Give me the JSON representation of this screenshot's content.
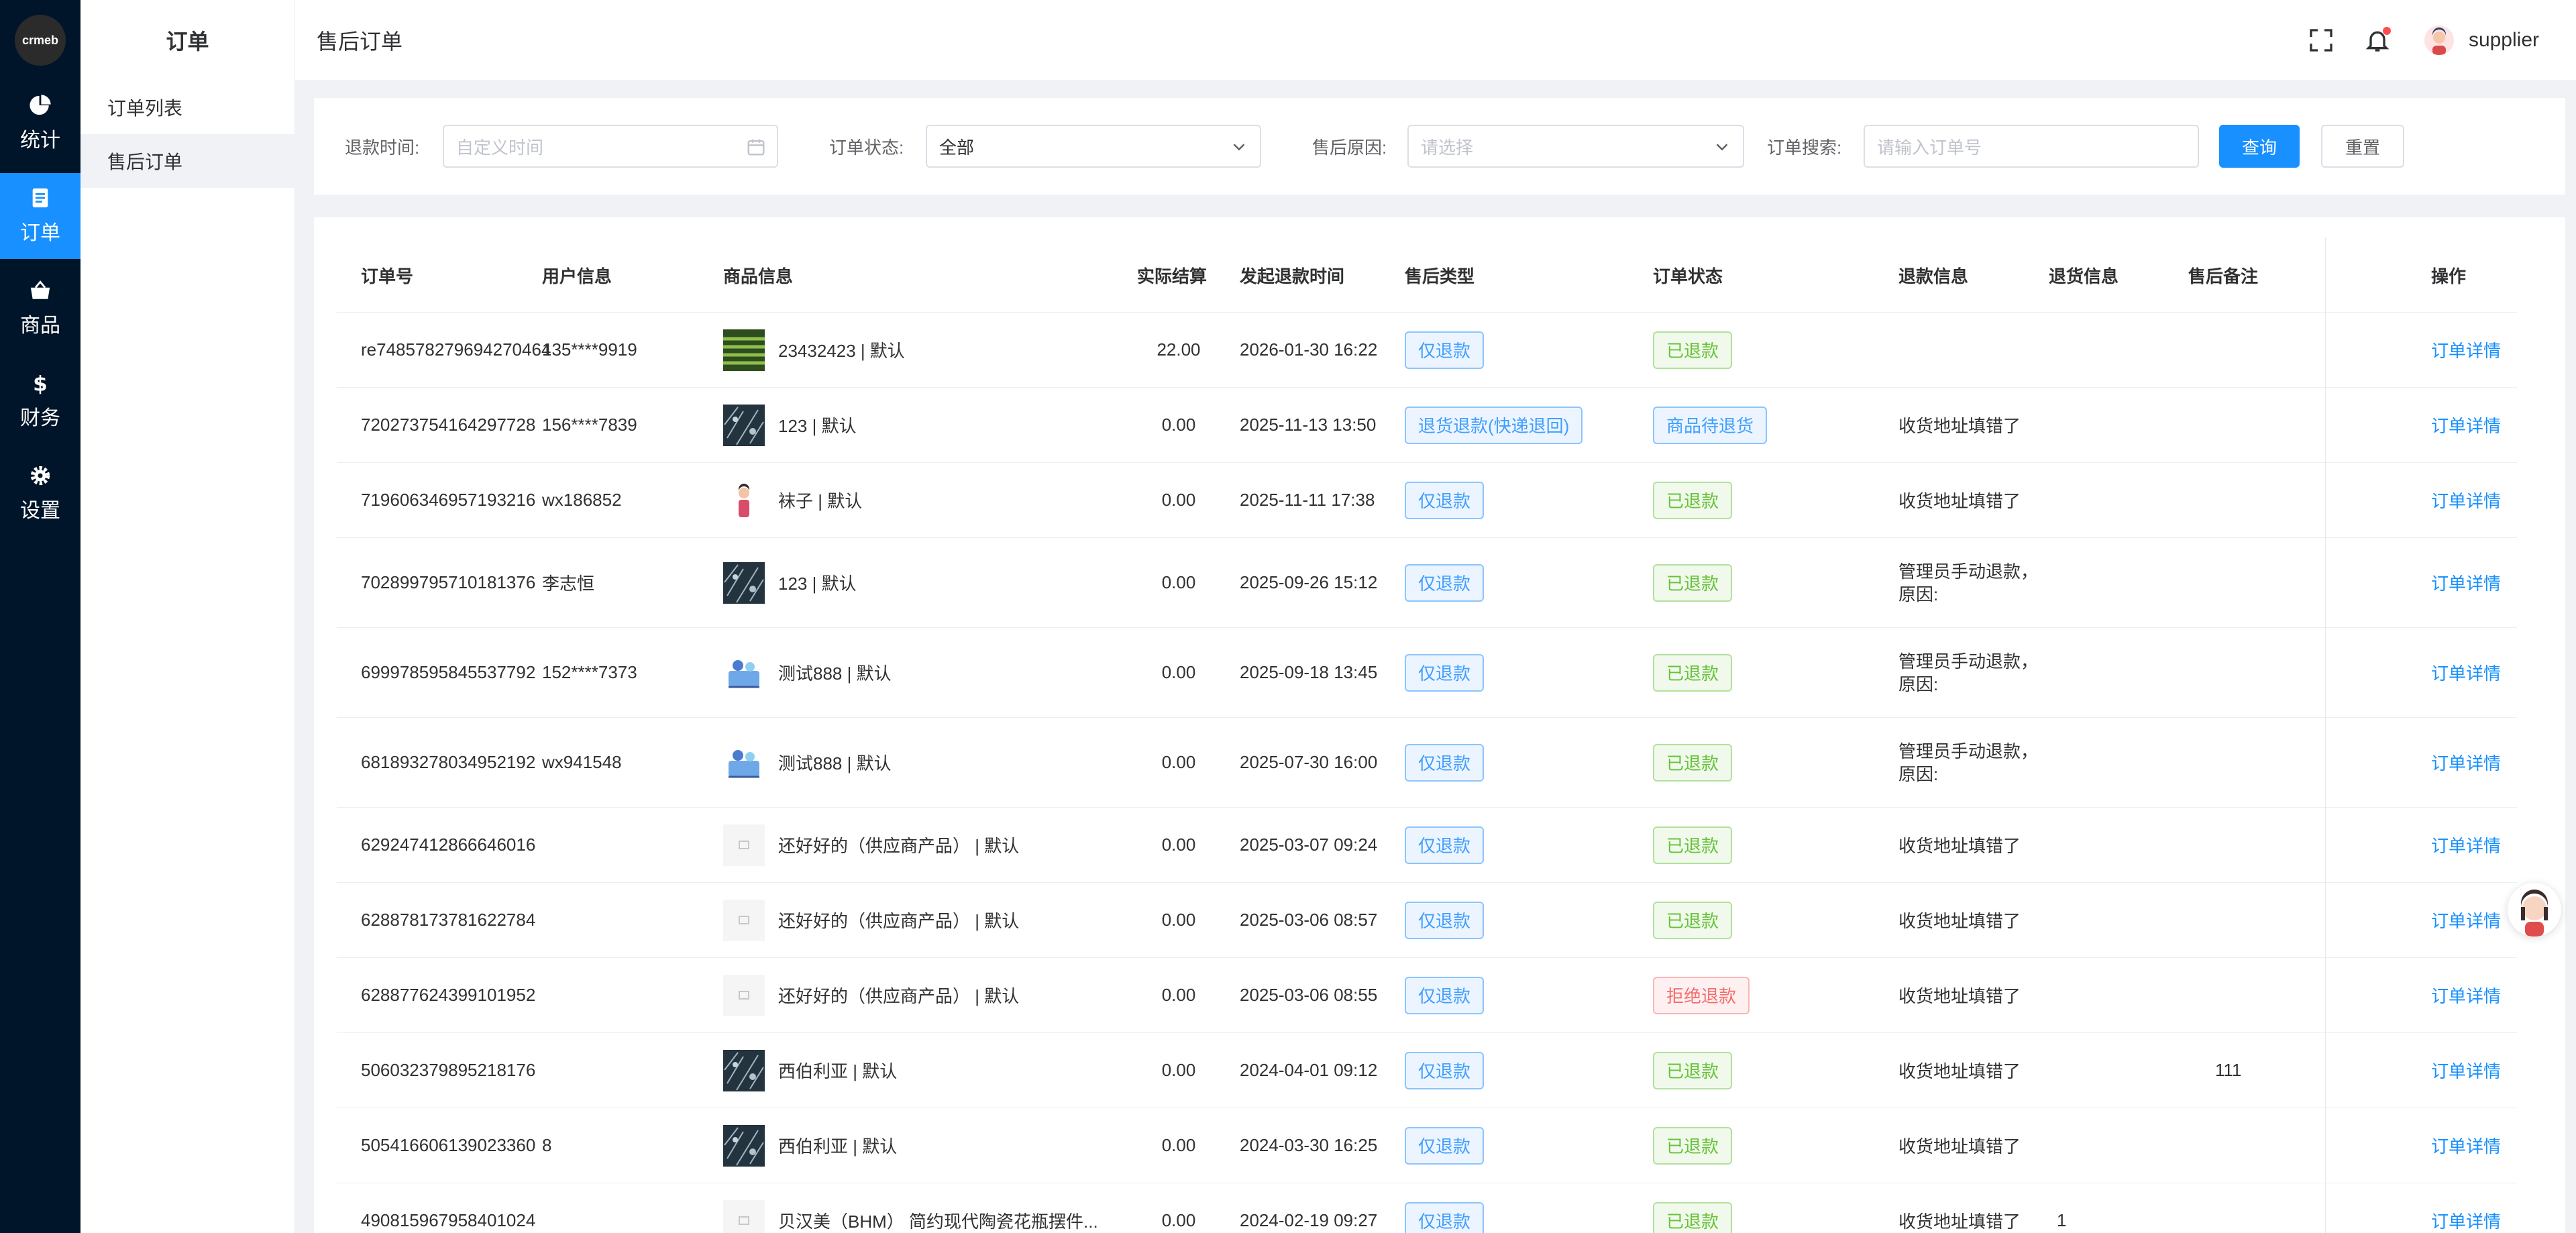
{
  "app": {
    "logo_text": "crmeb"
  },
  "rail": {
    "items": [
      {
        "label": "统计",
        "icon": "pie-chart-icon",
        "active": false
      },
      {
        "label": "订单",
        "icon": "order-document-icon",
        "active": true
      },
      {
        "label": "商品",
        "icon": "shopping-basket-icon",
        "active": false
      },
      {
        "label": "财务",
        "icon": "dollar-icon",
        "active": false
      },
      {
        "label": "设置",
        "icon": "gear-icon",
        "active": false
      }
    ]
  },
  "subnav": {
    "title": "订单",
    "items": [
      {
        "label": "订单列表",
        "active": false
      },
      {
        "label": "售后订单",
        "active": true
      }
    ]
  },
  "header": {
    "title": "售后订单",
    "username": "supplier",
    "icons": [
      "fullscreen-icon",
      "bell-icon"
    ]
  },
  "filters": {
    "refund_time": {
      "label": "退款时间:",
      "placeholder": "自定义时间"
    },
    "order_status": {
      "label": "订单状态:",
      "value": "全部"
    },
    "reason": {
      "label": "售后原因:",
      "placeholder": "请选择"
    },
    "search": {
      "label": "订单搜索:",
      "placeholder": "请输入订单号"
    },
    "query_label": "查询",
    "reset_label": "重置"
  },
  "table": {
    "columns": [
      "订单号",
      "用户信息",
      "商品信息",
      "实际结算",
      "发起退款时间",
      "售后类型",
      "订单状态",
      "退款信息",
      "退货信息",
      "售后备注",
      "操作"
    ],
    "rows": [
      {
        "order_no": "re748578279694270464",
        "user": "135****9919",
        "product": "23432423 | 默认",
        "thumb": "green",
        "amount": "22.00",
        "time": "2026-01-30 16:22",
        "type": "仅退款",
        "status": "已退款",
        "status_color": "green",
        "refund_info": "",
        "return_info": "",
        "remark": "",
        "action": "订单详情"
      },
      {
        "order_no": "720273754164297728",
        "user": "156****7839",
        "product": "123 | 默认",
        "thumb": "dark",
        "amount": "0.00",
        "time": "2025-11-13 13:50",
        "type": "退货退款(快递退回)",
        "status": "商品待退货",
        "status_color": "blue",
        "refund_info": "收货地址填错了",
        "return_info": "",
        "remark": "",
        "action": "订单详情"
      },
      {
        "order_no": "719606346957193216",
        "user": "wx186852",
        "product": "袜子 | 默认",
        "thumb": "person",
        "amount": "0.00",
        "time": "2025-11-11 17:38",
        "type": "仅退款",
        "status": "已退款",
        "status_color": "green",
        "refund_info": "收货地址填错了",
        "return_info": "",
        "remark": "",
        "action": "订单详情"
      },
      {
        "order_no": "702899795710181376",
        "user": "李志恒",
        "product": "123 | 默认",
        "thumb": "dark",
        "amount": "0.00",
        "time": "2025-09-26 15:12",
        "type": "仅退款",
        "status": "已退款",
        "status_color": "green",
        "refund_info": "管理员手动退款，",
        "refund_info_2": "原因:",
        "return_info": "",
        "remark": "",
        "action": "订单详情"
      },
      {
        "order_no": "699978595845537792",
        "user": "152****7373",
        "product": "测试888 | 默认",
        "thumb": "cartoon",
        "amount": "0.00",
        "time": "2025-09-18 13:45",
        "type": "仅退款",
        "status": "已退款",
        "status_color": "green",
        "refund_info": "管理员手动退款，",
        "refund_info_2": "原因:",
        "return_info": "",
        "remark": "",
        "action": "订单详情"
      },
      {
        "order_no": "681893278034952192",
        "user": "wx941548",
        "product": "测试888 | 默认",
        "thumb": "cartoon",
        "amount": "0.00",
        "time": "2025-07-30 16:00",
        "type": "仅退款",
        "status": "已退款",
        "status_color": "green",
        "refund_info": "管理员手动退款，",
        "refund_info_2": "原因:",
        "return_info": "",
        "remark": "",
        "action": "订单详情"
      },
      {
        "order_no": "629247412866646016",
        "user": "",
        "product": "还好好的（供应商产品） | 默认",
        "thumb": "blank",
        "amount": "0.00",
        "time": "2025-03-07 09:24",
        "type": "仅退款",
        "status": "已退款",
        "status_color": "green",
        "refund_info": "收货地址填错了",
        "return_info": "",
        "remark": "",
        "action": "订单详情"
      },
      {
        "order_no": "628878173781622784",
        "user": "",
        "product": "还好好的（供应商产品） | 默认",
        "thumb": "blank",
        "amount": "0.00",
        "time": "2025-03-06 08:57",
        "type": "仅退款",
        "status": "已退款",
        "status_color": "green",
        "refund_info": "收货地址填错了",
        "return_info": "",
        "remark": "",
        "action": "订单详情"
      },
      {
        "order_no": "628877624399101952",
        "user": "",
        "product": "还好好的（供应商产品） | 默认",
        "thumb": "blank",
        "amount": "0.00",
        "time": "2025-03-06 08:55",
        "type": "仅退款",
        "status": "拒绝退款",
        "status_color": "red",
        "refund_info": "收货地址填错了",
        "return_info": "",
        "remark": "",
        "action": "订单详情"
      },
      {
        "order_no": "506032379895218176",
        "user": "",
        "product": "西伯利亚 | 默认",
        "thumb": "dark",
        "amount": "0.00",
        "time": "2024-04-01 09:12",
        "type": "仅退款",
        "status": "已退款",
        "status_color": "green",
        "refund_info": "收货地址填错了",
        "return_info": "",
        "remark": "111",
        "action": "订单详情"
      },
      {
        "order_no": "505416606139023360",
        "user": "8",
        "product": "西伯利亚 | 默认",
        "thumb": "dark",
        "amount": "0.00",
        "time": "2024-03-30 16:25",
        "type": "仅退款",
        "status": "已退款",
        "status_color": "green",
        "refund_info": "收货地址填错了",
        "return_info": "",
        "remark": "",
        "action": "订单详情"
      },
      {
        "order_no": "490815967958401024",
        "user": "",
        "product": "贝汉美（BHM） 简约现代陶瓷花瓶摆件...",
        "thumb": "blank",
        "amount": "0.00",
        "time": "2024-02-19 09:27",
        "type": "仅退款",
        "status": "已退款",
        "status_color": "green",
        "refund_info": "收货地址填错了",
        "return_info": "1",
        "remark": "",
        "action": "订单详情"
      }
    ]
  }
}
